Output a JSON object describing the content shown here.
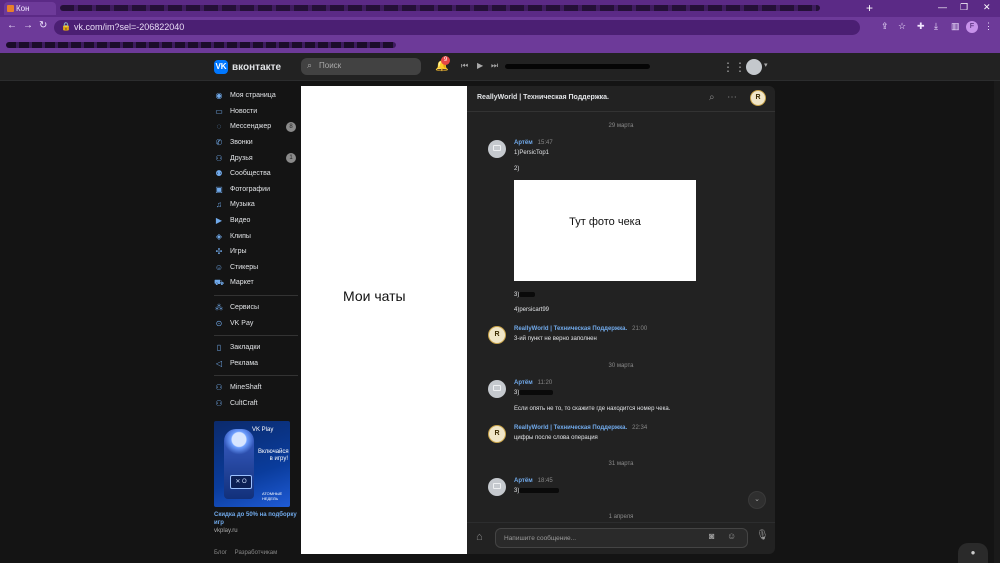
{
  "browser": {
    "tab_title": "Кон",
    "url": "vk.com/im?sel=-206822040",
    "profile_initial": "F"
  },
  "vk": {
    "logo_text": "вконтакте",
    "logo_mark": "VK",
    "search_placeholder": "Поиск",
    "notifications_count": "9"
  },
  "sidebar": {
    "items": [
      {
        "label": "Моя страница",
        "icon": "user-circle-icon"
      },
      {
        "label": "Новости",
        "icon": "news-icon"
      },
      {
        "label": "Мессенджер",
        "icon": "message-icon",
        "count": "8"
      },
      {
        "label": "Звонки",
        "icon": "phone-icon"
      },
      {
        "label": "Друзья",
        "icon": "friends-icon",
        "count": "1"
      },
      {
        "label": "Сообщества",
        "icon": "communities-icon"
      },
      {
        "label": "Фотографии",
        "icon": "photos-icon"
      },
      {
        "label": "Музыка",
        "icon": "music-icon"
      },
      {
        "label": "Видео",
        "icon": "video-icon"
      },
      {
        "label": "Клипы",
        "icon": "clips-icon"
      },
      {
        "label": "Игры",
        "icon": "games-icon"
      },
      {
        "label": "Стикеры",
        "icon": "stickers-icon"
      },
      {
        "label": "Маркет",
        "icon": "market-icon"
      }
    ],
    "services": [
      {
        "label": "Сервисы",
        "icon": "services-icon"
      },
      {
        "label": "VK Pay",
        "icon": "vkpay-icon"
      }
    ],
    "extra": [
      {
        "label": "Закладки",
        "icon": "bookmark-icon"
      },
      {
        "label": "Реклама",
        "icon": "megaphone-icon"
      }
    ],
    "groups": [
      {
        "label": "MineShaft",
        "icon": "group-icon"
      },
      {
        "label": "CultCraft",
        "icon": "group-icon"
      }
    ],
    "ad": {
      "brand": "VK Play",
      "slogan": "Включайся в игру!",
      "corner": "АТОМНЫЕ НЕДЕЛЬ",
      "tv": "✕ O",
      "title": "Скидка до 50% на подборку игр",
      "site": "vkplay.ru"
    },
    "footer_links": [
      "Блог",
      "Разработчикам"
    ]
  },
  "chat_list_placeholder": "Мои чаты",
  "conversation": {
    "title": "ReallyWorld | Техническая Поддержка.",
    "avatar_text": "R",
    "date_1": "29 марта",
    "date_2": "30 марта",
    "date_3": "31 марта",
    "date_4": "1 апреля",
    "msg1": {
      "author": "Артём",
      "time": "15:47",
      "line1": "1)PersicTop1",
      "line2": "2)",
      "photo_caption": "Тут фото чека",
      "line3": "3)",
      "line4": "4)persicart99"
    },
    "msg2": {
      "author": "ReallyWorld | Техническая Поддержка.",
      "time": "21:00",
      "line1": "3-ий пункт не верно заполнен"
    },
    "msg3": {
      "author": "Артём",
      "time": "11:20",
      "line1": "3)",
      "line2": "Если опять не то, то скажите где находится номер чека."
    },
    "msg4": {
      "author": "ReallyWorld | Техническая Поддержка.",
      "time": "22:34",
      "line1": "цифры после слова операция"
    },
    "msg5": {
      "author": "Артём",
      "time": "18:45",
      "line1": "3)"
    },
    "composer_placeholder": "Напишите сообщение..."
  }
}
